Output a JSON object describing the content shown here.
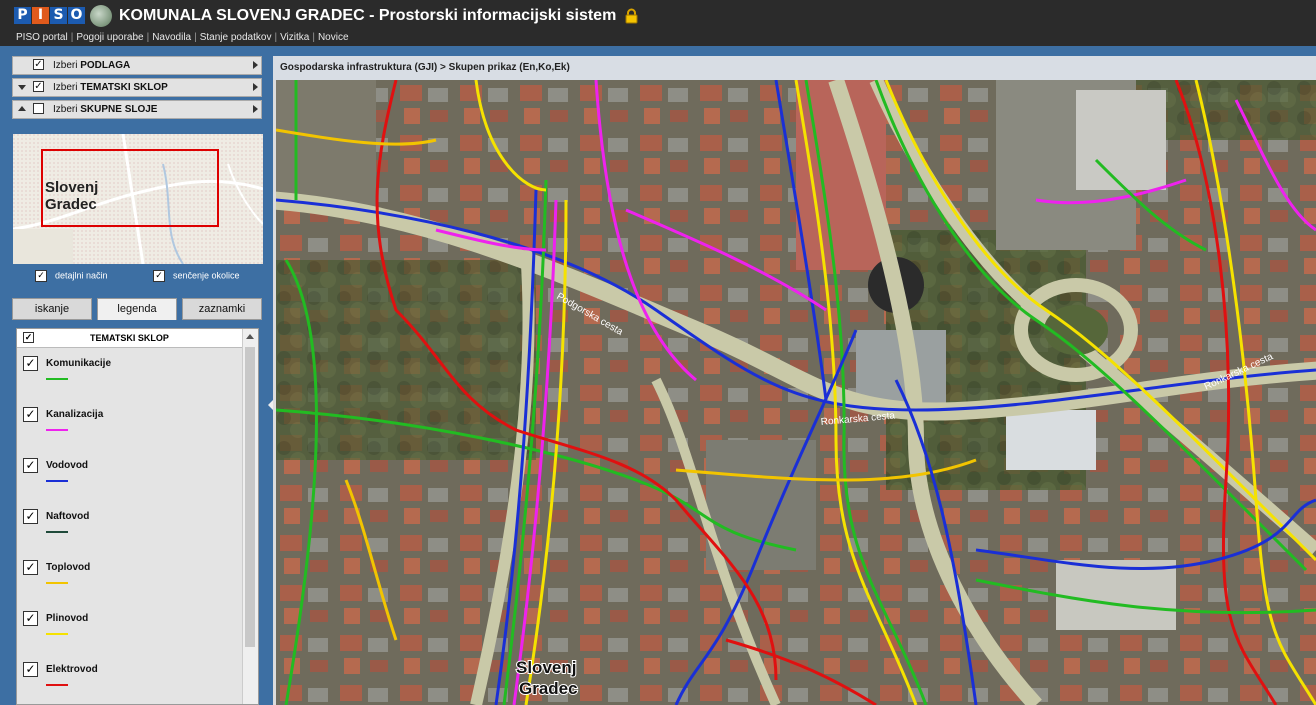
{
  "app": {
    "logo_letters": [
      "P",
      "I",
      "S",
      "O"
    ],
    "title": "KOMUNALA SLOVENJ GRADEC - Prostorski informacijski sistem"
  },
  "nav": {
    "links": [
      "PISO portal",
      "Pogoji uporabe",
      "Navodila",
      "Stanje podatkov",
      "Vizitka",
      "Novice"
    ],
    "separator": "|"
  },
  "layers": {
    "podlaga": {
      "label_prefix": "Izberi",
      "label_bold": "PODLAGA",
      "checked": true
    },
    "tematski": {
      "label_prefix": "Izberi",
      "label_bold": "TEMATSKI SKLOP",
      "checked": true
    },
    "skupne": {
      "label_prefix": "Izberi",
      "label_bold": "SKUPNE SLOJE",
      "checked": false
    }
  },
  "overview": {
    "label_line1": "Slovenj",
    "label_line2": "Gradec"
  },
  "options": {
    "detailed": {
      "label": "detajlni način",
      "checked": true
    },
    "shading": {
      "label": "senčenje okolice",
      "checked": true
    }
  },
  "tabs": [
    "iskanje",
    "legenda",
    "zaznamki"
  ],
  "active_tab": "legenda",
  "legend": {
    "header": "TEMATSKI SKLOP",
    "items": [
      {
        "name": "Komunikacije",
        "color": "#22bb22"
      },
      {
        "name": "Kanalizacija",
        "color": "#ee22ee"
      },
      {
        "name": "Vodovod",
        "color": "#1a2fd6"
      },
      {
        "name": "Naftovod",
        "color": "#1f4a3a"
      },
      {
        "name": "Toplovod",
        "color": "#f2c400"
      },
      {
        "name": "Plinovod",
        "color": "#f5e200"
      },
      {
        "name": "Elektrovod",
        "color": "#e01010"
      }
    ]
  },
  "map": {
    "breadcrumb": "Gospodarska infrastruktura (GJI) > Skupen prikaz (En,Ko,Ek)",
    "street_labels": [
      "Podgorska cesta",
      "Ronkarska cesta",
      "Ronkarska cesta"
    ],
    "place_label_line1": "Slovenj",
    "place_label_line2": "Gradec"
  }
}
